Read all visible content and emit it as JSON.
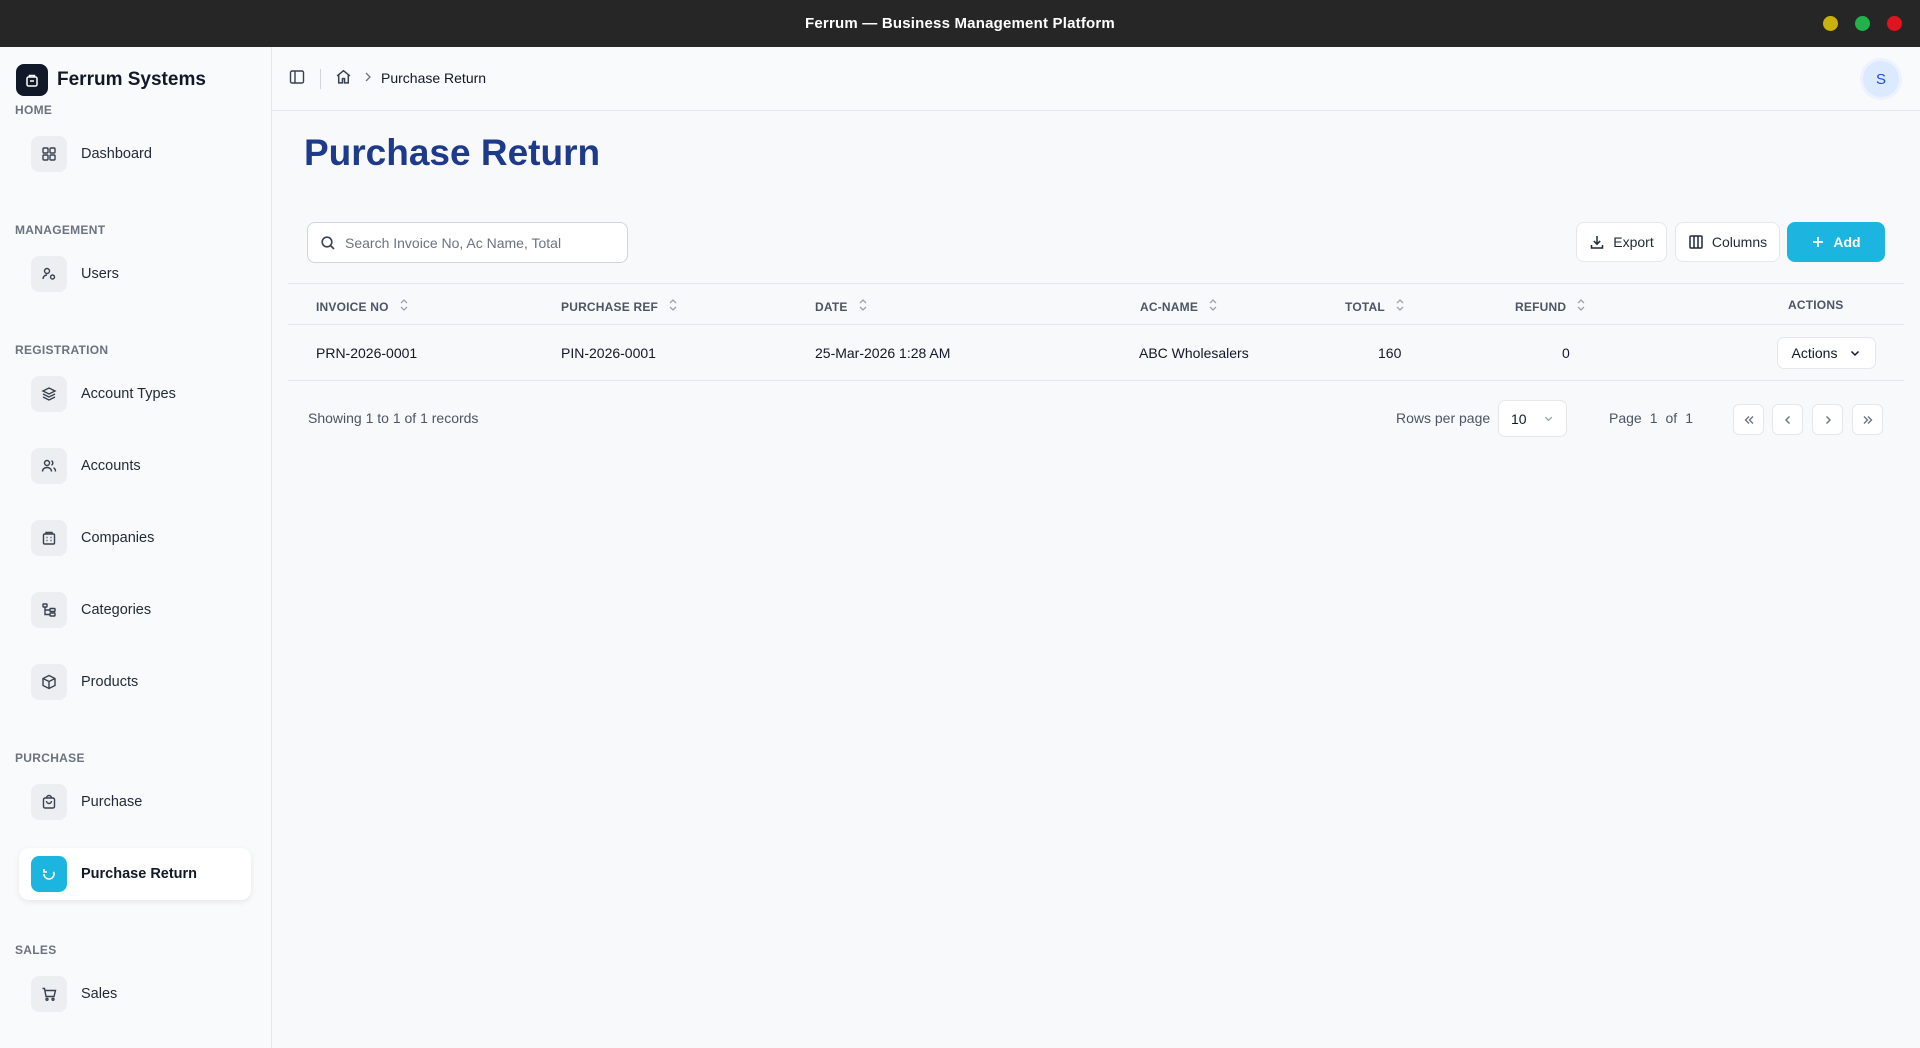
{
  "window": {
    "title": "Ferrum — Business Management Platform",
    "controls": [
      "minimize",
      "maximize",
      "close"
    ],
    "control_colors": [
      "#c9b20c",
      "#22b14c",
      "#e0141e"
    ]
  },
  "brand": {
    "name": "Ferrum Systems"
  },
  "sidebar": {
    "sections": [
      {
        "title": "HOME",
        "items": [
          {
            "label": "Dashboard",
            "icon": "dashboard-icon"
          }
        ]
      },
      {
        "title": "MANAGEMENT",
        "items": [
          {
            "label": "Users",
            "icon": "users-icon"
          }
        ]
      },
      {
        "title": "REGISTRATION",
        "items": [
          {
            "label": "Account Types",
            "icon": "layers-icon"
          },
          {
            "label": "Accounts",
            "icon": "people-icon"
          },
          {
            "label": "Companies",
            "icon": "building-icon"
          },
          {
            "label": "Categories",
            "icon": "tree-icon"
          },
          {
            "label": "Products",
            "icon": "package-icon"
          }
        ]
      },
      {
        "title": "PURCHASE",
        "items": [
          {
            "label": "Purchase",
            "icon": "bag-icon"
          },
          {
            "label": "Purchase Return",
            "icon": "refresh-icon",
            "active": true
          }
        ]
      },
      {
        "title": "SALES",
        "items": [
          {
            "label": "Sales",
            "icon": "cart-icon"
          }
        ]
      }
    ]
  },
  "topbar": {
    "breadcrumb": {
      "home_icon": "home-icon",
      "current": "Purchase Return"
    },
    "avatar_initial": "S"
  },
  "page": {
    "title": "Purchase Return"
  },
  "toolbar": {
    "search_placeholder": "Search Invoice No, Ac Name, Total",
    "search_value": "",
    "export_label": "Export",
    "columns_label": "Columns",
    "add_label": "Add",
    "accent_color": "#1cb5e0"
  },
  "table": {
    "columns": [
      "INVOICE NO",
      "PURCHASE REF",
      "DATE",
      "AC-NAME",
      "TOTAL",
      "REFUND",
      "ACTIONS"
    ],
    "rows": [
      {
        "invoice_no": "PRN-2026-0001",
        "purchase_ref": "PIN-2026-0001",
        "date": "25-Mar-2026 1:28 AM",
        "ac_name": "ABC Wholesalers",
        "total": "160",
        "refund": "0",
        "actions_label": "Actions"
      }
    ]
  },
  "pagination": {
    "showing_text": "Showing 1 to 1 of 1 records",
    "rows_per_page_label": "Rows per page",
    "rows_per_page_value": "10",
    "page_label": "Page",
    "current_page": "1",
    "of_label": "of",
    "total_pages": "1"
  }
}
